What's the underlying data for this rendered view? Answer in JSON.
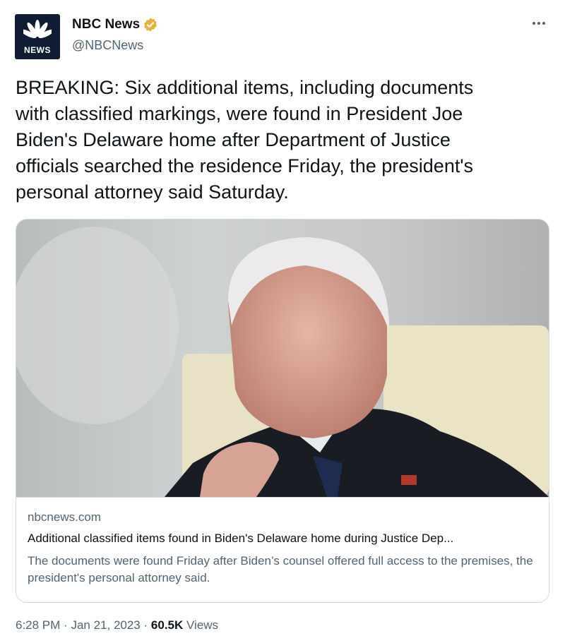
{
  "author": {
    "name": "NBC News",
    "handle": "@NBCNews",
    "avatar_label": "NEWS",
    "verified_icon": "verified-badge-icon",
    "verified_color": "#e8b23a"
  },
  "tweet": {
    "text": "BREAKING: Six additional items, including documents\nwith classified markings, were found in President Joe\nBiden's Delaware home after Department of Justice\nofficials searched the residence Friday, the president's\npersonal attorney said Saturday."
  },
  "card": {
    "domain": "nbcnews.com",
    "title": "Additional classified items found in Biden's Delaware home during Justice Dep...",
    "description": "The documents were found Friday after Biden’s counsel offered full access to the premises, the president's personal attorney said."
  },
  "meta": {
    "time": "6:28 PM",
    "date": "Jan 21, 2023",
    "separator": "·",
    "views_count": "60.5K",
    "views_label": "Views"
  }
}
